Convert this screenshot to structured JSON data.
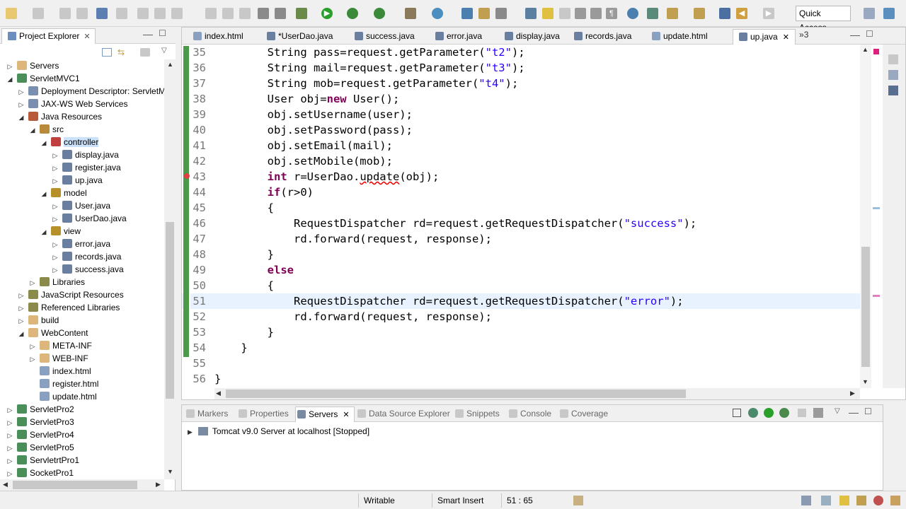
{
  "toolbar": {
    "quick_access": "Quick Access"
  },
  "project_explorer": {
    "title": "Project Explorer",
    "tree": [
      {
        "label": "Servers",
        "depth": 0,
        "twisty": "collapsed",
        "icon": "folder-icon",
        "color": "#dcb67a"
      },
      {
        "label": "ServletMVC1",
        "depth": 0,
        "twisty": "expanded",
        "icon": "project-icon",
        "color": "#4a8f5a"
      },
      {
        "label": "Deployment Descriptor: ServletM",
        "depth": 1,
        "twisty": "collapsed",
        "icon": "descriptor-icon",
        "color": "#7a8fb0"
      },
      {
        "label": "JAX-WS Web Services",
        "depth": 1,
        "twisty": "collapsed",
        "icon": "webservice-icon",
        "color": "#7a8fb0"
      },
      {
        "label": "Java Resources",
        "depth": 1,
        "twisty": "expanded",
        "icon": "java-resources-icon",
        "color": "#b85a3a"
      },
      {
        "label": "src",
        "depth": 2,
        "twisty": "expanded",
        "icon": "package-folder-icon",
        "color": "#b88a3a"
      },
      {
        "label": "controller",
        "depth": 3,
        "twisty": "expanded",
        "icon": "package-icon",
        "color": "#c04040",
        "selected": true
      },
      {
        "label": "display.java",
        "depth": 4,
        "twisty": "collapsed",
        "icon": "java-file-icon",
        "color": "#6a7fa0"
      },
      {
        "label": "register.java",
        "depth": 4,
        "twisty": "collapsed",
        "icon": "java-file-icon",
        "color": "#6a7fa0"
      },
      {
        "label": "up.java",
        "depth": 4,
        "twisty": "collapsed",
        "icon": "java-file-icon",
        "color": "#6a7fa0"
      },
      {
        "label": "model",
        "depth": 3,
        "twisty": "expanded",
        "icon": "package-icon",
        "color": "#b8902a"
      },
      {
        "label": "User.java",
        "depth": 4,
        "twisty": "collapsed",
        "icon": "java-file-icon",
        "color": "#6a7fa0"
      },
      {
        "label": "UserDao.java",
        "depth": 4,
        "twisty": "collapsed",
        "icon": "java-file-icon",
        "color": "#6a7fa0"
      },
      {
        "label": "view",
        "depth": 3,
        "twisty": "expanded",
        "icon": "package-icon",
        "color": "#b8902a"
      },
      {
        "label": "error.java",
        "depth": 4,
        "twisty": "collapsed",
        "icon": "java-file-icon",
        "color": "#6a7fa0"
      },
      {
        "label": "records.java",
        "depth": 4,
        "twisty": "collapsed",
        "icon": "java-file-icon",
        "color": "#6a7fa0"
      },
      {
        "label": "success.java",
        "depth": 4,
        "twisty": "collapsed",
        "icon": "java-file-icon",
        "color": "#6a7fa0"
      },
      {
        "label": "Libraries",
        "depth": 2,
        "twisty": "collapsed",
        "icon": "library-icon",
        "color": "#8a8a4a"
      },
      {
        "label": "JavaScript Resources",
        "depth": 1,
        "twisty": "collapsed",
        "icon": "js-resources-icon",
        "color": "#8a8a4a"
      },
      {
        "label": "Referenced Libraries",
        "depth": 1,
        "twisty": "collapsed",
        "icon": "library-icon",
        "color": "#8a8a4a"
      },
      {
        "label": "build",
        "depth": 1,
        "twisty": "collapsed",
        "icon": "folder-icon",
        "color": "#dcb67a"
      },
      {
        "label": "WebContent",
        "depth": 1,
        "twisty": "expanded",
        "icon": "folder-icon",
        "color": "#dcb67a"
      },
      {
        "label": "META-INF",
        "depth": 2,
        "twisty": "collapsed",
        "icon": "folder-icon",
        "color": "#dcb67a"
      },
      {
        "label": "WEB-INF",
        "depth": 2,
        "twisty": "collapsed",
        "icon": "folder-icon",
        "color": "#dcb67a"
      },
      {
        "label": "index.html",
        "depth": 2,
        "twisty": "none",
        "icon": "html-file-icon",
        "color": "#8aa0c0"
      },
      {
        "label": "register.html",
        "depth": 2,
        "twisty": "none",
        "icon": "html-file-icon",
        "color": "#8aa0c0"
      },
      {
        "label": "update.html",
        "depth": 2,
        "twisty": "none",
        "icon": "html-file-icon",
        "color": "#8aa0c0"
      },
      {
        "label": "ServletPro2",
        "depth": 0,
        "twisty": "collapsed",
        "icon": "project-icon",
        "color": "#4a8f5a"
      },
      {
        "label": "ServletPro3",
        "depth": 0,
        "twisty": "collapsed",
        "icon": "project-icon",
        "color": "#4a8f5a"
      },
      {
        "label": "ServletPro4",
        "depth": 0,
        "twisty": "collapsed",
        "icon": "project-icon",
        "color": "#4a8f5a"
      },
      {
        "label": "ServletPro5",
        "depth": 0,
        "twisty": "collapsed",
        "icon": "project-icon",
        "color": "#4a8f5a"
      },
      {
        "label": "ServletrtPro1",
        "depth": 0,
        "twisty": "collapsed",
        "icon": "project-icon",
        "color": "#4a8f5a"
      },
      {
        "label": "SocketPro1",
        "depth": 0,
        "twisty": "collapsed",
        "icon": "project-icon",
        "color": "#4a8f5a"
      }
    ]
  },
  "editor": {
    "tabs": [
      {
        "label": "index.html",
        "icon": "html-file-icon"
      },
      {
        "label": "*UserDao.java",
        "icon": "java-file-icon"
      },
      {
        "label": "success.java",
        "icon": "java-file-icon"
      },
      {
        "label": "error.java",
        "icon": "java-file-icon"
      },
      {
        "label": "display.java",
        "icon": "java-file-icon"
      },
      {
        "label": "records.java",
        "icon": "java-file-icon"
      },
      {
        "label": "update.html",
        "icon": "html-file-icon"
      },
      {
        "label": "up.java",
        "icon": "java-file-icon",
        "active": true
      }
    ],
    "overflow_count": "3",
    "current_line": "51",
    "lines": [
      {
        "n": "35",
        "segs": [
          [
            "t",
            "        String pass=request.getParameter("
          ],
          [
            "s",
            "\"t2\""
          ],
          [
            "t",
            ");"
          ]
        ]
      },
      {
        "n": "36",
        "segs": [
          [
            "t",
            "        String mail=request.getParameter("
          ],
          [
            "s",
            "\"t3\""
          ],
          [
            "t",
            ");"
          ]
        ]
      },
      {
        "n": "37",
        "segs": [
          [
            "t",
            "        String mob=request.getParameter("
          ],
          [
            "s",
            "\"t4\""
          ],
          [
            "t",
            ");"
          ]
        ]
      },
      {
        "n": "38",
        "segs": [
          [
            "t",
            "        User obj="
          ],
          [
            "k",
            "new"
          ],
          [
            "t",
            " User();"
          ]
        ]
      },
      {
        "n": "39",
        "segs": [
          [
            "t",
            "        obj.setUsername(user);"
          ]
        ]
      },
      {
        "n": "40",
        "segs": [
          [
            "t",
            "        obj.setPassword(pass);"
          ]
        ]
      },
      {
        "n": "41",
        "segs": [
          [
            "t",
            "        obj.setEmail(mail);"
          ]
        ]
      },
      {
        "n": "42",
        "segs": [
          [
            "t",
            "        obj.setMobile(mob);"
          ]
        ]
      },
      {
        "n": "43",
        "segs": [
          [
            "k",
            "        int"
          ],
          [
            "t",
            " r=UserDao."
          ],
          [
            "e",
            "update"
          ],
          [
            "t",
            "(obj);"
          ]
        ]
      },
      {
        "n": "44",
        "segs": [
          [
            "k",
            "        if"
          ],
          [
            "t",
            "(r>0)"
          ]
        ]
      },
      {
        "n": "45",
        "segs": [
          [
            "t",
            "        {"
          ]
        ]
      },
      {
        "n": "46",
        "segs": [
          [
            "t",
            "            RequestDispatcher rd=request.getRequestDispatcher("
          ],
          [
            "s",
            "\"success\""
          ],
          [
            "t",
            ");"
          ]
        ]
      },
      {
        "n": "47",
        "segs": [
          [
            "t",
            "            rd.forward(request, response);"
          ]
        ]
      },
      {
        "n": "48",
        "segs": [
          [
            "t",
            "        }"
          ]
        ]
      },
      {
        "n": "49",
        "segs": [
          [
            "k",
            "        else"
          ]
        ]
      },
      {
        "n": "50",
        "segs": [
          [
            "t",
            "        {"
          ]
        ]
      },
      {
        "n": "51",
        "segs": [
          [
            "t",
            "            RequestDispatcher rd=request.getRequestDispatcher("
          ],
          [
            "s",
            "\"error\""
          ],
          [
            "t",
            ");"
          ]
        ]
      },
      {
        "n": "52",
        "segs": [
          [
            "t",
            "            rd.forward(request, response);"
          ]
        ]
      },
      {
        "n": "53",
        "segs": [
          [
            "t",
            "        }"
          ]
        ]
      },
      {
        "n": "54",
        "segs": [
          [
            "t",
            "    }"
          ]
        ]
      },
      {
        "n": "55",
        "segs": [
          [
            "t",
            ""
          ]
        ]
      },
      {
        "n": "56",
        "segs": [
          [
            "t",
            "}"
          ]
        ]
      }
    ]
  },
  "bottom_panel": {
    "tabs": [
      {
        "label": "Markers"
      },
      {
        "label": "Properties"
      },
      {
        "label": "Servers",
        "active": true
      },
      {
        "label": "Data Source Explorer"
      },
      {
        "label": "Snippets"
      },
      {
        "label": "Console"
      },
      {
        "label": "Coverage"
      }
    ],
    "server_entry": "Tomcat v9.0 Server at localhost  [Stopped]"
  },
  "status_bar": {
    "writable": "Writable",
    "insert_mode": "Smart Insert",
    "position": "51 : 65"
  },
  "colors": {
    "keyword": "#7f0055",
    "string": "#2a00ff",
    "selection": "#cce2fa",
    "current_line": "#e8f2fe"
  }
}
